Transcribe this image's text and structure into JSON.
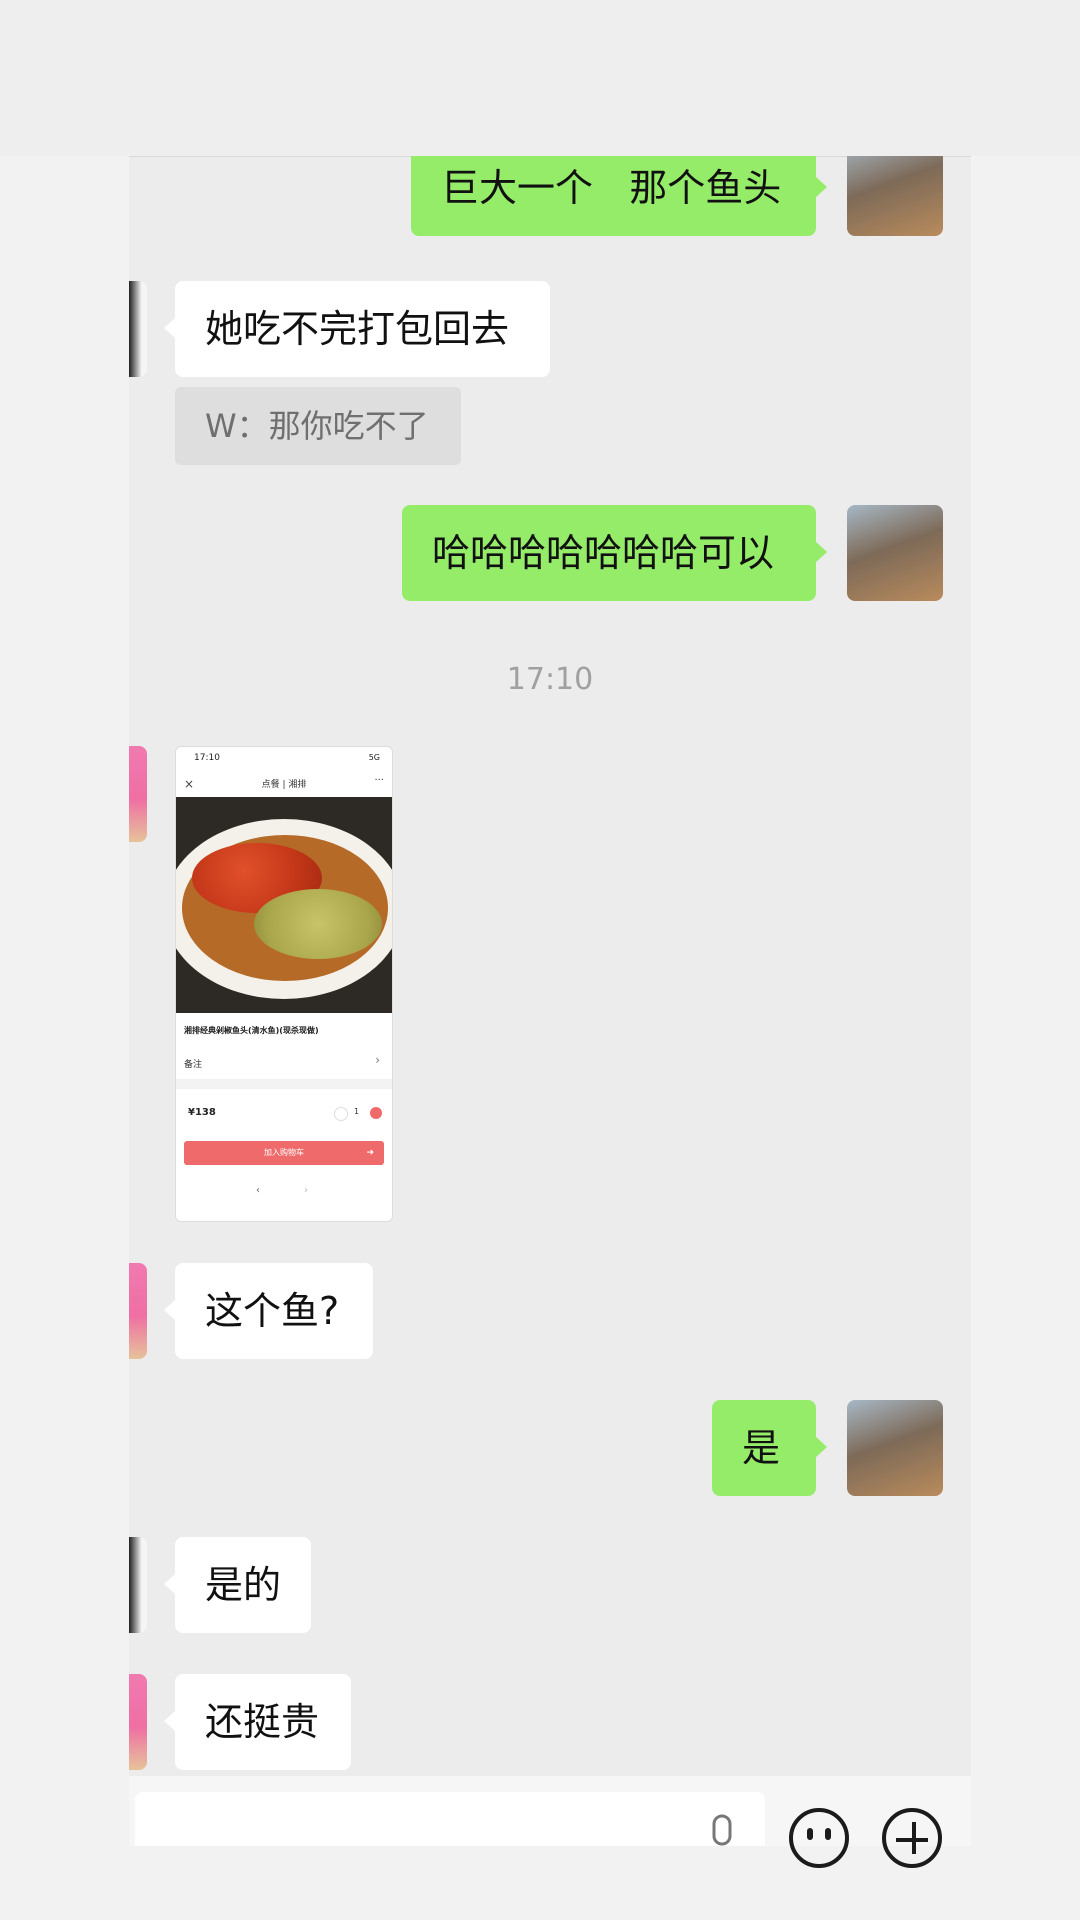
{
  "messages": {
    "m1": "巨大一个   那个鱼头",
    "m2": "她吃不完打包回去",
    "quote": "W：那你吃不了",
    "m3": "哈哈哈哈哈哈哈可以",
    "timestamp": "17:10",
    "m4": "这个鱼?",
    "m5": "是",
    "m6": "是的",
    "m7": "还挺贵"
  },
  "image_card": {
    "status_time": "17:10",
    "status_right": "5G",
    "header_title": "点餐 | 湘排",
    "close": "×",
    "more": "···",
    "dish_desc": "湘排经典剁椒鱼头(清水鱼)(现杀现做)",
    "note_label": "备注",
    "note_chevron": "›",
    "price": "¥138",
    "qty": "1",
    "add_to_cart": "加入购物车",
    "cart_arrow": "➜",
    "nav_prev": "‹",
    "nav_next": "›"
  },
  "icons": {
    "mic": "microphone-icon",
    "emoji": "emoji-icon",
    "plus": "plus-icon"
  },
  "colors": {
    "my_bubble": "#95ec69",
    "their_bubble": "#ffffff",
    "chat_background": "#ececec",
    "quote_background": "#dedede"
  }
}
